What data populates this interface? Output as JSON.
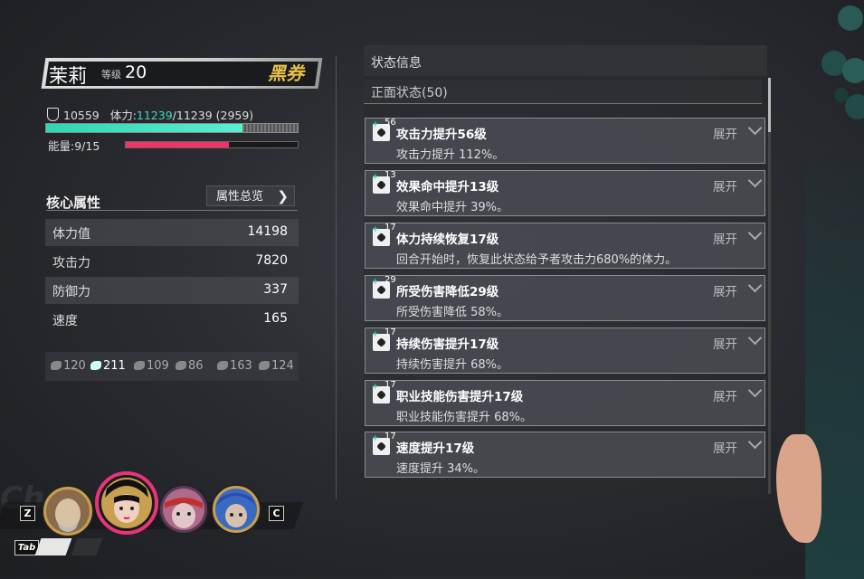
{
  "character": {
    "name": "茉莉",
    "level_label": "等级",
    "level": "20",
    "brand": "黑券",
    "defense_value": "10559",
    "hp_label": "体力:",
    "hp_current": "11239",
    "hp_rest": "/11239 (2959)",
    "hp_fill_fraction": 0.78,
    "energy_label": "能量:9/15",
    "energy_fill_fraction": 0.6
  },
  "core": {
    "title": "核心属性",
    "overview_button": "属性总览",
    "attributes": [
      {
        "label": "体力值",
        "value": "14198"
      },
      {
        "label": "攻击力",
        "value": "7820"
      },
      {
        "label": "防御力",
        "value": "337"
      },
      {
        "label": "速度",
        "value": "165"
      }
    ],
    "resistances": [
      "120",
      "211",
      "109",
      "86",
      "163",
      "124"
    ]
  },
  "party": {
    "bg_text": "Chu",
    "key_left": "Z",
    "key_right": "C",
    "tab_key": "Tab",
    "avatar_colors": [
      "#8a6a4a",
      "#c8a050",
      "#b06a8a",
      "#3a6ac0"
    ],
    "selected_color": "#e8347a"
  },
  "status": {
    "title": "状态信息",
    "positive_header": "正面状态(50)",
    "expand_label": "展开",
    "effects": [
      {
        "level": "56",
        "title": "攻击力提升56级",
        "desc": "攻击力提升 112%。"
      },
      {
        "level": "13",
        "title": "效果命中提升13级",
        "desc": "效果命中提升 39%。"
      },
      {
        "level": "17",
        "title": "体力持续恢复17级",
        "desc": "回合开始时，恢复此状态给予者攻击力680%的体力。"
      },
      {
        "level": "29",
        "title": "所受伤害降低29级",
        "desc": "所受伤害降低 58%。"
      },
      {
        "level": "17",
        "title": "持续伤害提升17级",
        "desc": "持续伤害提升 68%。"
      },
      {
        "level": "17",
        "title": "职业技能伤害提升17级",
        "desc": "职业技能伤害提升 68%。"
      },
      {
        "level": "17",
        "title": "速度提升17级",
        "desc": "速度提升 34%。"
      }
    ]
  },
  "colors": {
    "accent_cyan": "#3fd8c0",
    "energy_pink": "#f0346a",
    "brand_gold": "#e8c14a"
  }
}
